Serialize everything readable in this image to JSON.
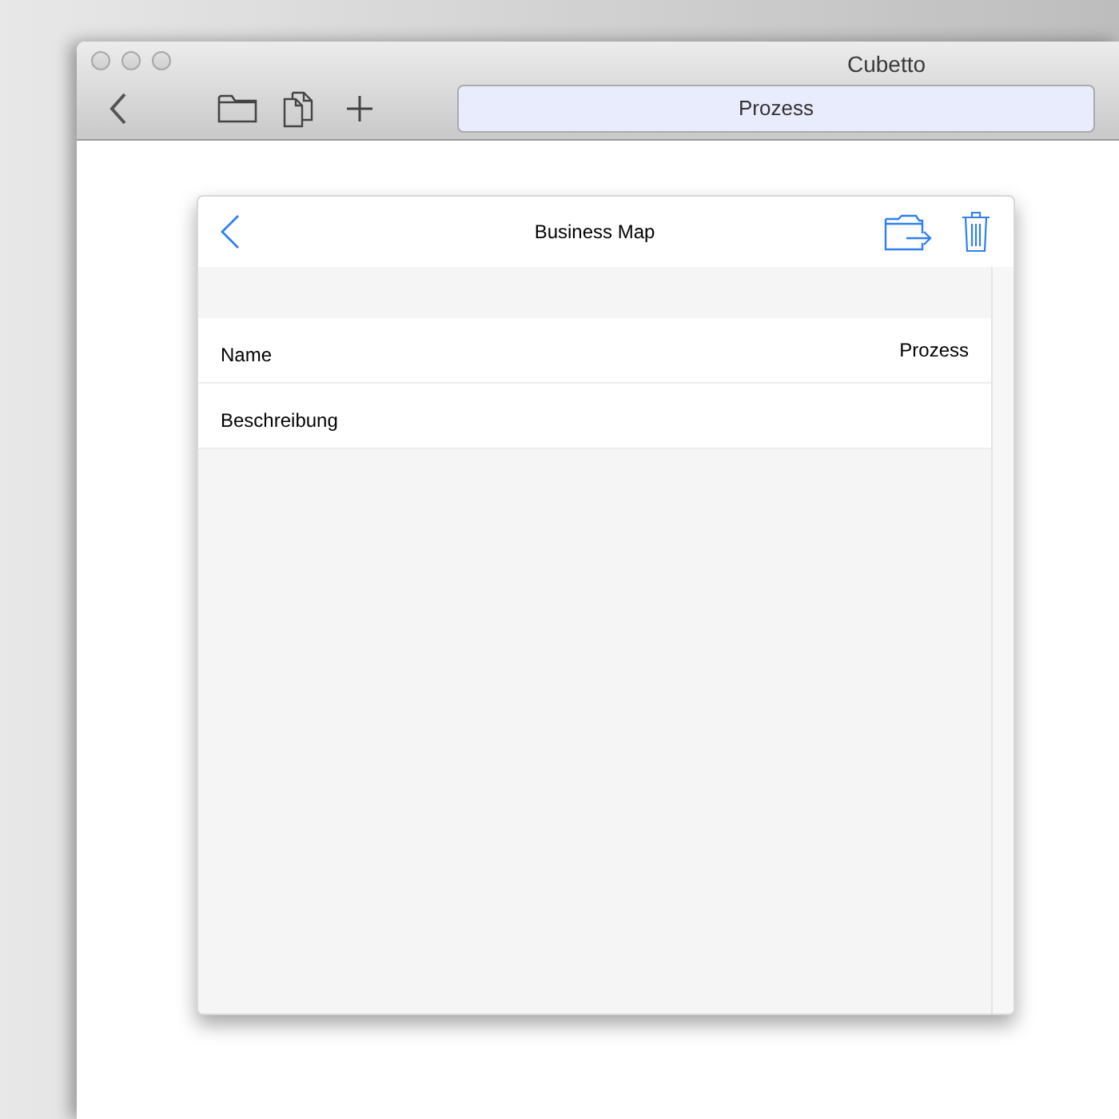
{
  "window": {
    "title": "Cubetto"
  },
  "toolbar": {
    "search_value": "Prozess"
  },
  "panel": {
    "title": "Business Map",
    "fields": [
      {
        "label": "Name",
        "value": "Prozess"
      },
      {
        "label": "Beschreibung"
      }
    ]
  }
}
